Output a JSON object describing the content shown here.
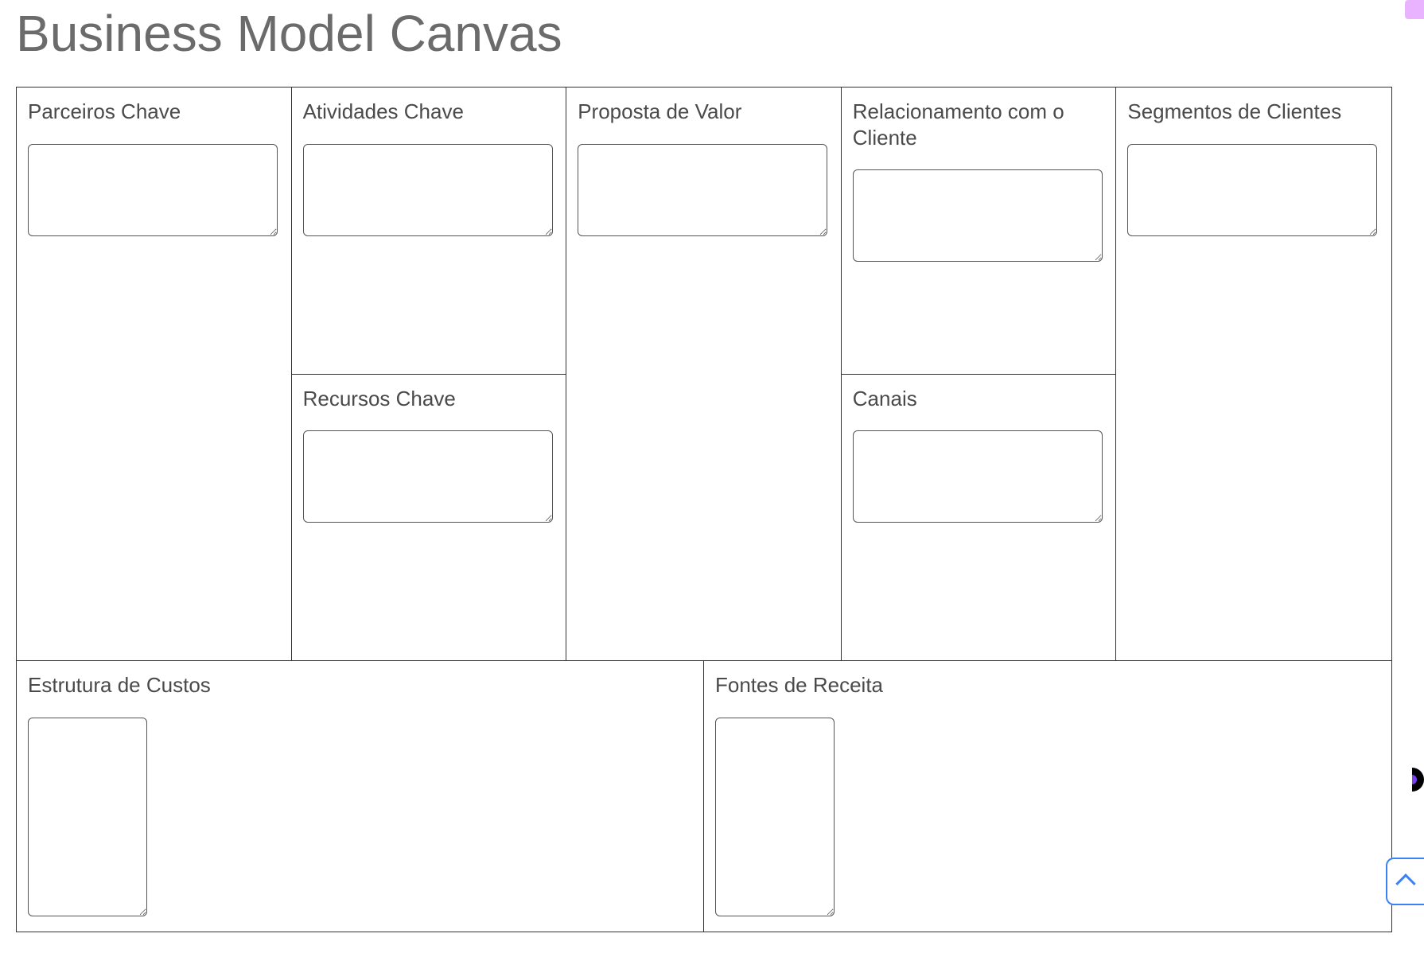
{
  "title": "Business Model Canvas",
  "blocks": {
    "key_partners": {
      "label": "Parceiros Chave",
      "value": ""
    },
    "key_activities": {
      "label": "Atividades Chave",
      "value": ""
    },
    "key_resources": {
      "label": "Recursos Chave",
      "value": ""
    },
    "value_proposition": {
      "label": "Proposta de Valor",
      "value": ""
    },
    "customer_relationships": {
      "label": "Relacionamento com o Cliente",
      "value": ""
    },
    "channels": {
      "label": "Canais",
      "value": ""
    },
    "customer_segments": {
      "label": "Segmentos de Clientes",
      "value": ""
    },
    "cost_structure": {
      "label": "Estrutura de Custos",
      "value": ""
    },
    "revenue_streams": {
      "label": "Fontes de Receita",
      "value": ""
    }
  }
}
